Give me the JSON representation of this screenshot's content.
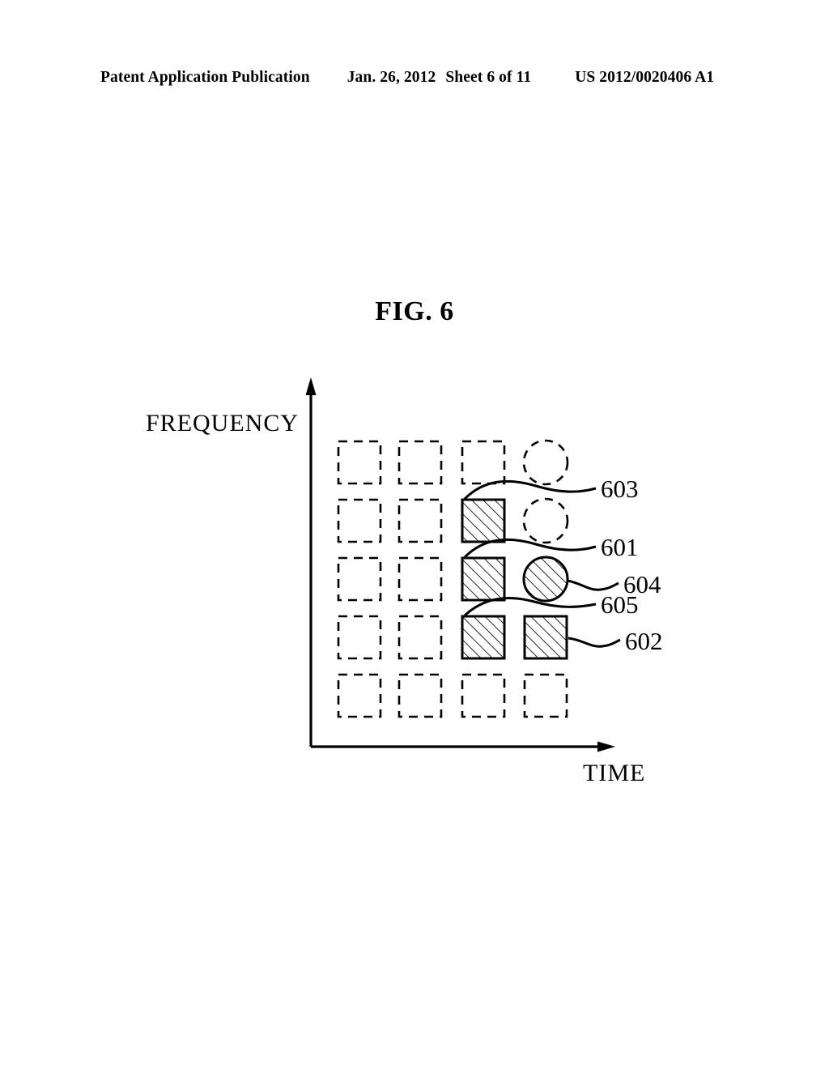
{
  "header": {
    "publication": "Patent Application Publication",
    "date": "Jan. 26, 2012",
    "sheet": "Sheet 6 of 11",
    "patent_number": "US 2012/0020406 A1"
  },
  "figure": {
    "title": "FIG. 6",
    "y_axis_label": "FREQUENCY",
    "x_axis_label": "TIME"
  },
  "callouts": {
    "c603": "603",
    "c601": "601",
    "c604": "604",
    "c605": "605",
    "c602": "602"
  },
  "chart_data": {
    "type": "heatmap",
    "title": "FIG. 6",
    "xlabel": "TIME",
    "ylabel": "FREQUENCY",
    "grid": "5 rows x 4 columns of resource elements",
    "rows": 5,
    "columns": 4,
    "cells": [
      [
        {
          "shape": "square",
          "style": "dashed",
          "ref": null
        },
        {
          "shape": "square",
          "style": "dashed",
          "ref": null
        },
        {
          "shape": "square",
          "style": "dashed",
          "ref": null
        },
        {
          "shape": "circle",
          "style": "dashed",
          "ref": null
        }
      ],
      [
        {
          "shape": "square",
          "style": "dashed",
          "ref": null
        },
        {
          "shape": "square",
          "style": "dashed",
          "ref": null
        },
        {
          "shape": "square",
          "style": "hatched",
          "ref": "603"
        },
        {
          "shape": "circle",
          "style": "dashed",
          "ref": null
        }
      ],
      [
        {
          "shape": "square",
          "style": "dashed",
          "ref": null
        },
        {
          "shape": "square",
          "style": "dashed",
          "ref": null
        },
        {
          "shape": "square",
          "style": "hatched",
          "ref": "601"
        },
        {
          "shape": "circle",
          "style": "hatched",
          "ref": "604"
        }
      ],
      [
        {
          "shape": "square",
          "style": "dashed",
          "ref": null
        },
        {
          "shape": "square",
          "style": "dashed",
          "ref": null
        },
        {
          "shape": "square",
          "style": "hatched",
          "ref": "605"
        },
        {
          "shape": "square",
          "style": "hatched",
          "ref": "602"
        }
      ],
      [
        {
          "shape": "square",
          "style": "dashed",
          "ref": null
        },
        {
          "shape": "square",
          "style": "dashed",
          "ref": null
        },
        {
          "shape": "square",
          "style": "dashed",
          "ref": null
        },
        {
          "shape": "square",
          "style": "dashed",
          "ref": null
        }
      ]
    ],
    "legend": [
      {
        "ref": "603",
        "description": "hatched square, row 2 column 3"
      },
      {
        "ref": "601",
        "description": "hatched square, row 3 column 3"
      },
      {
        "ref": "604",
        "description": "hatched circle, row 3 column 4"
      },
      {
        "ref": "605",
        "description": "hatched square, row 4 column 3"
      },
      {
        "ref": "602",
        "description": "hatched square, row 4 column 4"
      }
    ],
    "colors": {
      "line": "#000000",
      "fill": "#ffffff"
    }
  }
}
